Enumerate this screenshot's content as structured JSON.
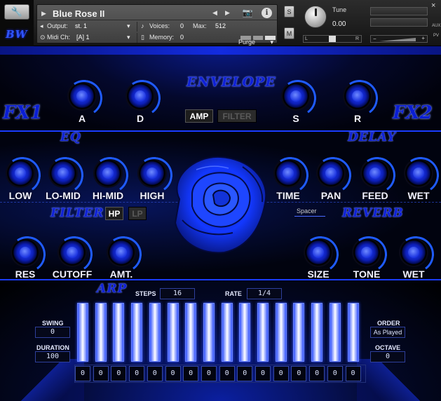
{
  "header": {
    "logo": "BW",
    "instrument_name": "Blue Rose II",
    "output_label": "Output:",
    "output_value": "st. 1",
    "voices_label": "Voices:",
    "voices_value": "0",
    "max_label": "Max:",
    "max_value": "512",
    "purge_label": "Purge",
    "midi_label": "Midi Ch:",
    "midi_value": "[A]  1",
    "memory_label": "Memory:",
    "memory_value": "0",
    "solo_label": "S",
    "mute_label": "M",
    "tune_label": "Tune",
    "tune_value": "0.00",
    "pan_left": "L",
    "pan_right": "R",
    "vol_minus": "−",
    "vol_plus": "+",
    "aux_label": "AUX",
    "pv_label": "PV",
    "close_glyph": "×",
    "camera_icon": "camera-icon",
    "info_glyph": "i",
    "nav_prev": "◀",
    "nav_next": "▶",
    "name_arrow": "▶"
  },
  "envelope": {
    "title": "ENVELOPE",
    "knobs": [
      {
        "label": "A"
      },
      {
        "label": "D"
      },
      {
        "label": "S"
      },
      {
        "label": "R"
      }
    ],
    "amp_label": "AMP",
    "filter_label": "FILTER",
    "active_tab": "AMP"
  },
  "fx1": "FX1",
  "fx2": "FX2",
  "eq": {
    "title": "EQ",
    "knobs": [
      {
        "label": "LOW"
      },
      {
        "label": "LO-MID"
      },
      {
        "label": "HI-MID"
      },
      {
        "label": "HIGH"
      }
    ]
  },
  "delay": {
    "title": "DELAY",
    "knobs": [
      {
        "label": "TIME"
      },
      {
        "label": "PAN"
      },
      {
        "label": "FEED"
      },
      {
        "label": "WET"
      }
    ]
  },
  "filter": {
    "title": "FILTER",
    "hp_label": "HP",
    "lp_label": "LP",
    "active": "HP",
    "knobs": [
      {
        "label": "RES"
      },
      {
        "label": "CUTOFF"
      },
      {
        "label": "AMT."
      }
    ]
  },
  "spacer_label": "Spacer",
  "reverb": {
    "title": "REVERB",
    "knobs": [
      {
        "label": "SIZE"
      },
      {
        "label": "TONE"
      },
      {
        "label": "WET"
      }
    ]
  },
  "arp": {
    "title": "ARP",
    "steps_label": "STEPS",
    "steps_value": "16",
    "rate_label": "RATE",
    "rate_value": "1/4",
    "swing_label": "SWING",
    "swing_value": "0",
    "duration_label": "DURATION",
    "duration_value": "100",
    "order_label": "ORDER",
    "order_value": "As Played",
    "octave_label": "OCTAVE",
    "octave_value": "0",
    "step_values": [
      "0",
      "0",
      "0",
      "0",
      "0",
      "0",
      "0",
      "0",
      "0",
      "0",
      "0",
      "0",
      "0",
      "0",
      "0",
      "0"
    ]
  },
  "colors": {
    "accent": "#1a3cff",
    "script_title": "#0f21d6",
    "bar_glow": "#2e4fff"
  }
}
